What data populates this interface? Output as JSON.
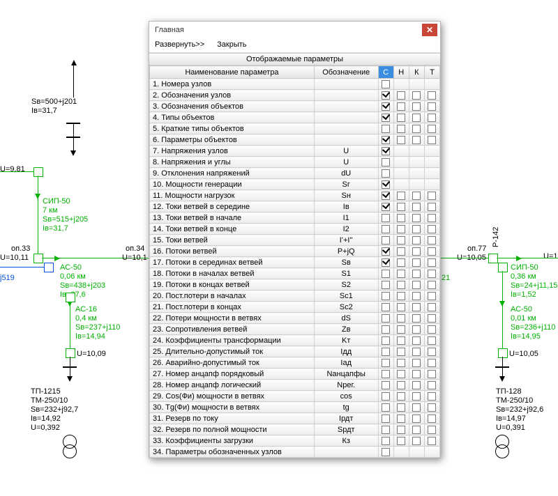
{
  "dialog": {
    "title": "Главная",
    "expand": "Развернуть>>",
    "close": "Закрыть",
    "group": "Отображаемые параметры",
    "cols": {
      "name": "Наименование параметра",
      "sym": "Обозначение",
      "c": "С",
      "n": "Н",
      "k": "К",
      "t": "Т"
    },
    "rows": [
      {
        "name": "1. Номера узлов",
        "sym": "",
        "cols": "c",
        "c": false
      },
      {
        "name": "2. Обозначения узлов",
        "sym": "",
        "cols": "cnkt",
        "c": true,
        "n": false,
        "k": false,
        "t": false
      },
      {
        "name": "3. Обозначения объектов",
        "sym": "",
        "cols": "cnkt",
        "c": true,
        "n": false,
        "k": false,
        "t": false
      },
      {
        "name": "4. Типы объектов",
        "sym": "",
        "cols": "cnkt",
        "c": true,
        "n": false,
        "k": false,
        "t": false
      },
      {
        "name": "5. Краткие типы объектов",
        "sym": "",
        "cols": "cnkt",
        "c": false,
        "n": false,
        "k": false,
        "t": false
      },
      {
        "name": "6. Параметры объектов",
        "sym": "",
        "cols": "cnkt",
        "c": true,
        "n": false,
        "k": false,
        "t": false
      },
      {
        "name": "7. Напряжения узлов",
        "sym": "U",
        "cols": "c",
        "c": true
      },
      {
        "name": "8. Напряжения и углы",
        "sym": "U",
        "cols": "c",
        "c": false
      },
      {
        "name": "9. Отклонения напряжений",
        "sym": "dU",
        "cols": "c",
        "c": false
      },
      {
        "name": "10. Мощности генерации",
        "sym": "Sг",
        "cols": "c",
        "c": true
      },
      {
        "name": "11. Мощности нагрузок",
        "sym": "Sн",
        "cols": "cnkt",
        "c": true,
        "n": false,
        "k": false,
        "t": false
      },
      {
        "name": "12. Токи ветвей в середине",
        "sym": "Iв",
        "cols": "cnkt",
        "c": true,
        "n": false,
        "k": false,
        "t": false
      },
      {
        "name": "13. Токи ветвей в начале",
        "sym": "I1",
        "cols": "cnkt",
        "c": false,
        "n": false,
        "k": false,
        "t": false
      },
      {
        "name": "14. Токи ветвей в конце",
        "sym": "I2",
        "cols": "cnkt",
        "c": false,
        "n": false,
        "k": false,
        "t": false
      },
      {
        "name": "15. Токи ветвей",
        "sym": "I'+I''",
        "cols": "cnkt",
        "c": false,
        "n": false,
        "k": false,
        "t": false
      },
      {
        "name": "16. Потоки ветвей",
        "sym": "P+jQ",
        "cols": "cnkt",
        "c": true,
        "n": false,
        "k": false,
        "t": false
      },
      {
        "name": "17. Потоки в серединах ветвей",
        "sym": "Sв",
        "cols": "cnkt",
        "c": true,
        "n": false,
        "k": false,
        "t": false
      },
      {
        "name": "18. Потоки в началах ветвей",
        "sym": "S1",
        "cols": "cnkt",
        "c": false,
        "n": false,
        "k": false,
        "t": false
      },
      {
        "name": "19. Потоки в концах ветвей",
        "sym": "S2",
        "cols": "cnkt",
        "c": false,
        "n": false,
        "k": false,
        "t": false
      },
      {
        "name": "20. Пост.потери в началах",
        "sym": "Sс1",
        "cols": "cnkt",
        "c": false,
        "n": false,
        "k": false,
        "t": false
      },
      {
        "name": "21. Пост.потери в концах",
        "sym": "Sс2",
        "cols": "cnkt",
        "c": false,
        "n": false,
        "k": false,
        "t": false
      },
      {
        "name": "22. Потери мощности в ветвях",
        "sym": "dS",
        "cols": "cnkt",
        "c": false,
        "n": false,
        "k": false,
        "t": false
      },
      {
        "name": "23. Сопротивления ветвей",
        "sym": "Zв",
        "cols": "cnkt",
        "c": false,
        "n": false,
        "k": false,
        "t": false
      },
      {
        "name": "24. Коэффициенты трансформации",
        "sym": "Kт",
        "cols": "cnkt",
        "c": false,
        "n": false,
        "k": false,
        "t": false
      },
      {
        "name": "25. Длительно-допустимый ток",
        "sym": "Iдд",
        "cols": "cnkt",
        "c": false,
        "n": false,
        "k": false,
        "t": false
      },
      {
        "name": "26. Аварийно-допустимый ток",
        "sym": "Iад",
        "cols": "cnkt",
        "c": false,
        "n": false,
        "k": false,
        "t": false
      },
      {
        "name": "27. Номер анцапф порядковый",
        "sym": "Nанцапфы",
        "cols": "cnkt",
        "c": false,
        "n": false,
        "k": false,
        "t": false
      },
      {
        "name": "28. Номер анцапф логический",
        "sym": "Nрег.",
        "cols": "cnkt",
        "c": false,
        "n": false,
        "k": false,
        "t": false
      },
      {
        "name": "29. Cos(Фи) мощности в ветвях",
        "sym": "cos",
        "cols": "cnkt",
        "c": false,
        "n": false,
        "k": false,
        "t": false
      },
      {
        "name": "30. Tg(Фи) мощности в ветвях",
        "sym": "tg",
        "cols": "cnkt",
        "c": false,
        "n": false,
        "k": false,
        "t": false
      },
      {
        "name": "31. Резерв по току",
        "sym": "Iрдт",
        "cols": "cnkt",
        "c": false,
        "n": false,
        "k": false,
        "t": false
      },
      {
        "name": "32. Резерв по полной мощности",
        "sym": "Sрдт",
        "cols": "cnkt",
        "c": false,
        "n": false,
        "k": false,
        "t": false
      },
      {
        "name": "33. Коэффициенты загрузки",
        "sym": "Кз",
        "cols": "cnkt",
        "c": false,
        "n": false,
        "k": false,
        "t": false
      },
      {
        "name": "34. Параметры обозначенных узлов",
        "sym": "",
        "cols": "c",
        "c": false
      }
    ]
  },
  "sch": {
    "u981": "U=9,81",
    "sv500": "Sв=500+j201\nIв=31,7",
    "sip50": "СИП-50\n7 км\nSв=515+j205\nIв=31,7",
    "op33": "оп.33",
    "op34": "оп.34",
    "u1011": "U=10,11",
    "u101": "U=10,1",
    "ac50": "АС-50\n0,06 км\nSв=438+j203\nIв=27,6",
    "j519": "j519",
    "ac16": "АС-16\n0,4 км\nSв=237+j110\nIв=14,94",
    "u1009": "U=10,09",
    "tp1215": "ТП-1215\nТМ-250/10\nSв=232+j92,7\nIв=14,92\nU=0,392",
    "op77": "оп.77",
    "u1005": "U=10,05",
    "p142": "Р-142",
    "label21": "21",
    "sip50r": "СИП-50\n0,36 км\nSв=24+j11,15\nIв=1,52",
    "ac50r": "АС-50\n0,01 км\nSв=236+j110\nIв=14,95",
    "u1005b": "U=10,05",
    "tp128": "ТП-128\nТМ-250/10\nSв=232+j92,6\nIв=14,97\nU=0,391",
    "u1": "U=1"
  }
}
